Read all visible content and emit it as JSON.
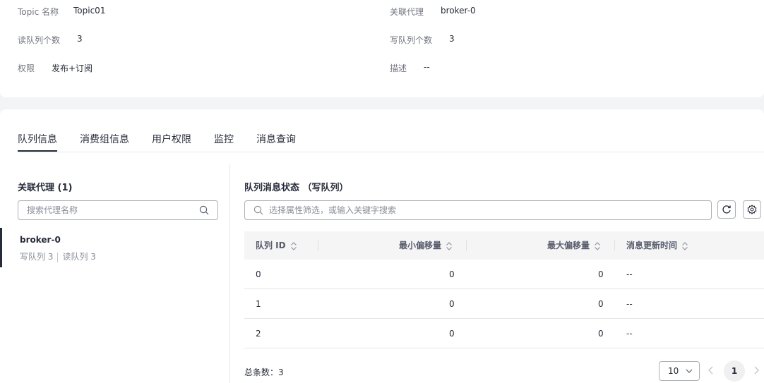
{
  "overview": {
    "topic_label": "Topic 名称",
    "topic_value": "Topic01",
    "broker_label": "关联代理",
    "broker_value": "broker-0",
    "read_queue_label": "读队列个数",
    "read_queue_value": "3",
    "write_queue_label": "写队列个数",
    "write_queue_value": "3",
    "permission_label": "权限",
    "permission_value": "发布+订阅",
    "desc_label": "描述",
    "desc_value": "--"
  },
  "tabs": [
    {
      "label": "队列信息",
      "active": true
    },
    {
      "label": "消费组信息",
      "active": false
    },
    {
      "label": "用户权限",
      "active": false
    },
    {
      "label": "监控",
      "active": false
    },
    {
      "label": "消息查询",
      "active": false
    }
  ],
  "left": {
    "title": "关联代理 (1)",
    "search_placeholder": "搜索代理名称",
    "broker": {
      "name": "broker-0",
      "write": "写队列 3",
      "read": "读队列 3"
    }
  },
  "right": {
    "title": "队列消息状态 （写队列）",
    "filter_placeholder": "选择属性筛选，或输入关键字搜索",
    "columns": [
      "队列 ID",
      "最小偏移量",
      "最大偏移量",
      "消息更新时间"
    ],
    "rows": [
      {
        "id": "0",
        "min": "0",
        "max": "0",
        "time": "--"
      },
      {
        "id": "1",
        "min": "0",
        "max": "0",
        "time": "--"
      },
      {
        "id": "2",
        "min": "0",
        "max": "0",
        "time": "--"
      }
    ],
    "total": "总条数：3",
    "page_size": "10",
    "current_page": "1"
  },
  "colors": {
    "text": "#252b3a",
    "muted": "#71757f",
    "border": "#adb0b8",
    "page_bg": "#f3f4f6"
  }
}
